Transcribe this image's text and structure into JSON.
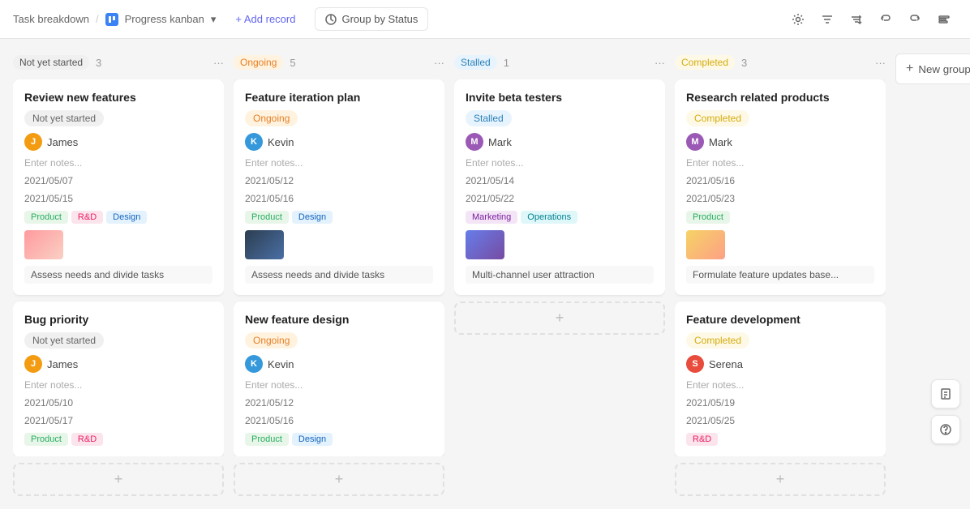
{
  "header": {
    "breadcrumb": "Task breakdown",
    "separator": "/",
    "view_label": "Progress kanban",
    "view_dropdown": "▾",
    "add_record_label": "+ Add record",
    "group_by_label": "Group by Status",
    "undo_icon": "↩",
    "redo_icon": "↪",
    "search_icon": "⊟"
  },
  "new_group_label": "+ New group",
  "columns": [
    {
      "id": "not-yet-started",
      "title": "Not yet started",
      "count": "3",
      "badge_class": "col-badge-not-started",
      "dot_class": "dot-not-started",
      "cards": [
        {
          "id": "review-new-features",
          "title": "Review new features",
          "status": "Not yet started",
          "status_badge": "badge-not-started",
          "assignee": "James",
          "avatar_class": "avatar-j",
          "avatar_letter": "J",
          "notes": "Enter notes...",
          "date1": "2021/05/07",
          "date2": "2021/05/15",
          "tags": [
            {
              "label": "Product",
              "class": "tag-product"
            },
            {
              "label": "R&D",
              "class": "tag-rd"
            },
            {
              "label": "Design",
              "class": "tag-design"
            }
          ],
          "has_image": true,
          "img_class": "img-pink",
          "task_label": "Assess needs and divide tasks"
        },
        {
          "id": "bug-priority",
          "title": "Bug priority",
          "status": "Not yet started",
          "status_badge": "badge-not-started",
          "assignee": "James",
          "avatar_class": "avatar-j",
          "avatar_letter": "J",
          "notes": "Enter notes...",
          "date1": "2021/05/10",
          "date2": "2021/05/17",
          "tags": [
            {
              "label": "Product",
              "class": "tag-product"
            },
            {
              "label": "R&D",
              "class": "tag-rd"
            }
          ],
          "has_image": false,
          "task_label": ""
        }
      ]
    },
    {
      "id": "ongoing",
      "title": "Ongoing",
      "count": "5",
      "badge_class": "col-badge-ongoing",
      "dot_class": "dot-ongoing",
      "cards": [
        {
          "id": "feature-iteration-plan",
          "title": "Feature iteration plan",
          "status": "Ongoing",
          "status_badge": "badge-ongoing",
          "assignee": "Kevin",
          "avatar_class": "avatar-k",
          "avatar_letter": "K",
          "notes": "Enter notes...",
          "date1": "2021/05/12",
          "date2": "2021/05/16",
          "tags": [
            {
              "label": "Product",
              "class": "tag-product"
            },
            {
              "label": "Design",
              "class": "tag-design"
            }
          ],
          "has_image": true,
          "img_class": "img-dark",
          "task_label": "Assess needs and divide tasks"
        },
        {
          "id": "new-feature-design",
          "title": "New feature design",
          "status": "Ongoing",
          "status_badge": "badge-ongoing",
          "assignee": "Kevin",
          "avatar_class": "avatar-k",
          "avatar_letter": "K",
          "notes": "Enter notes...",
          "date1": "2021/05/12",
          "date2": "2021/05/16",
          "tags": [
            {
              "label": "Product",
              "class": "tag-product"
            },
            {
              "label": "Design",
              "class": "tag-design"
            }
          ],
          "has_image": false,
          "task_label": ""
        }
      ]
    },
    {
      "id": "stalled",
      "title": "Stalled",
      "count": "1",
      "badge_class": "col-badge-stalled",
      "dot_class": "dot-stalled",
      "cards": [
        {
          "id": "invite-beta-testers",
          "title": "Invite beta testers",
          "status": "Stalled",
          "status_badge": "badge-stalled",
          "assignee": "Mark",
          "avatar_class": "avatar-m",
          "avatar_letter": "M",
          "notes": "Enter notes...",
          "date1": "2021/05/14",
          "date2": "2021/05/22",
          "tags": [
            {
              "label": "Marketing",
              "class": "tag-marketing"
            },
            {
              "label": "Operations",
              "class": "tag-operations"
            }
          ],
          "has_image": true,
          "img_class": "img-blue",
          "task_label": "Multi-channel user attraction"
        }
      ]
    },
    {
      "id": "completed",
      "title": "Completed",
      "count": "3",
      "badge_class": "col-badge-completed",
      "dot_class": "dot-completed",
      "cards": [
        {
          "id": "research-related-products",
          "title": "Research related products",
          "status": "Completed",
          "status_badge": "badge-completed",
          "assignee": "Mark",
          "avatar_class": "avatar-m",
          "avatar_letter": "M",
          "notes": "Enter notes...",
          "date1": "2021/05/16",
          "date2": "2021/05/23",
          "tags": [
            {
              "label": "Product",
              "class": "tag-product"
            }
          ],
          "has_image": true,
          "img_class": "img-food",
          "task_label": "Formulate feature updates base..."
        },
        {
          "id": "feature-development",
          "title": "Feature development",
          "status": "Completed",
          "status_badge": "badge-completed",
          "assignee": "Serena",
          "avatar_class": "avatar-s",
          "avatar_letter": "S",
          "notes": "Enter notes...",
          "date1": "2021/05/19",
          "date2": "2021/05/25",
          "tags": [
            {
              "label": "R&D",
              "class": "tag-rd"
            }
          ],
          "has_image": false,
          "task_label": ""
        }
      ]
    }
  ]
}
